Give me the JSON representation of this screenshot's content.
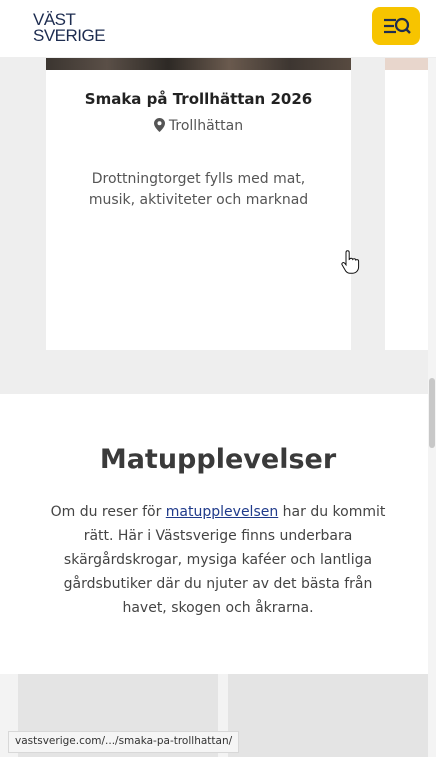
{
  "header": {
    "logo_line1": "VÄST",
    "logo_line2": "SVERIGE"
  },
  "event_card": {
    "title": "Smaka på Trollhättan 2026",
    "location": "Trollhättan",
    "description": "Drottningtorget fylls med mat, musik, aktiviteter och marknad"
  },
  "section": {
    "title": "Matupplevelser",
    "text_before_link": "Om du reser för ",
    "link_text": "matupplevelsen",
    "text_after_link": " har du kommit rätt. Här i Västsverige finns underbara skärgårdskrogar, mysiga kaféer och lantliga gårdsbutiker där du njuter av det bästa från havet, skogen och åkrarna."
  },
  "status_bar": {
    "url": "vastsverige.com/.../smaka-pa-trollhattan/"
  },
  "colors": {
    "menu_button": "#f7c400",
    "logo_text": "#1d2c50",
    "link": "#1f3a8a",
    "band_background": "#eeeeee"
  },
  "icons": {
    "menu": "menu-search-icon",
    "location": "map-pin-icon",
    "cursor": "hand-pointer-icon"
  }
}
